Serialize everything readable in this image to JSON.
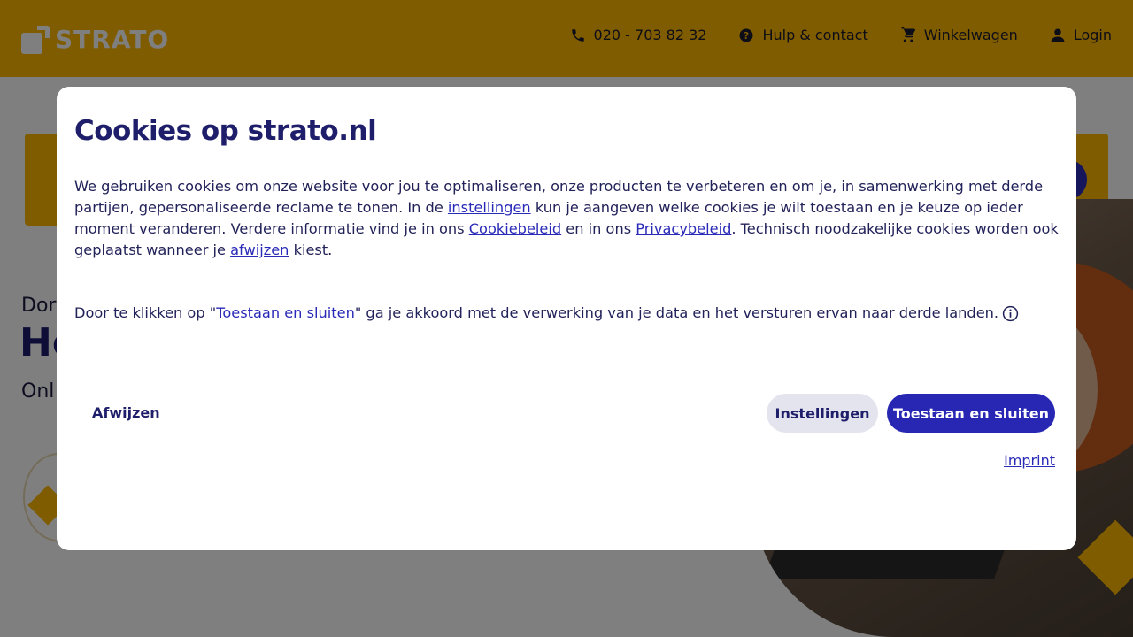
{
  "header": {
    "logo_text": "STRATO",
    "nav": {
      "phone": "020 - 703 82 32",
      "help": "Hulp & contact",
      "cart": "Winkelwagen",
      "login": "Login"
    }
  },
  "hero": {
    "line1": "Dor",
    "line2": "Ho",
    "line3": "Onl"
  },
  "dialog": {
    "title": "Cookies op strato.nl",
    "body": {
      "t1": "We gebruiken cookies om onze website voor jou te optimaliseren, onze producten te verbeteren en om je, in samenwerking met derde partijen, gepersonaliseerde reclame te tonen. In de ",
      "link_settings": "instellingen",
      "t2": " kun je aangeven welke cookies je wilt toestaan en je keuze op ieder moment veranderen. Verdere informatie vind je in ons ",
      "link_cookie": "Cookiebeleid",
      "t3": " en in ons ",
      "link_privacy": "Privacybeleid",
      "t4": ". Technisch noodzakelijke cookies worden ook geplaatst wanneer je ",
      "link_reject": "afwijzen",
      "t5": " kiest."
    },
    "consent": {
      "t1": "Door te klikken op \"",
      "link_accept": "Toestaan en sluiten",
      "t2": "\" ga je akkoord met de verwerking van je data en het versturen ervan naar derde landen."
    },
    "buttons": {
      "reject": "Afwijzen",
      "settings": "Instellingen",
      "accept": "Toestaan en sluiten"
    },
    "imprint": "Imprint"
  },
  "colors": {
    "brand_yellow": "#ffb900",
    "primary_blue": "#2727b4",
    "text_navy": "#1e1e6a"
  }
}
